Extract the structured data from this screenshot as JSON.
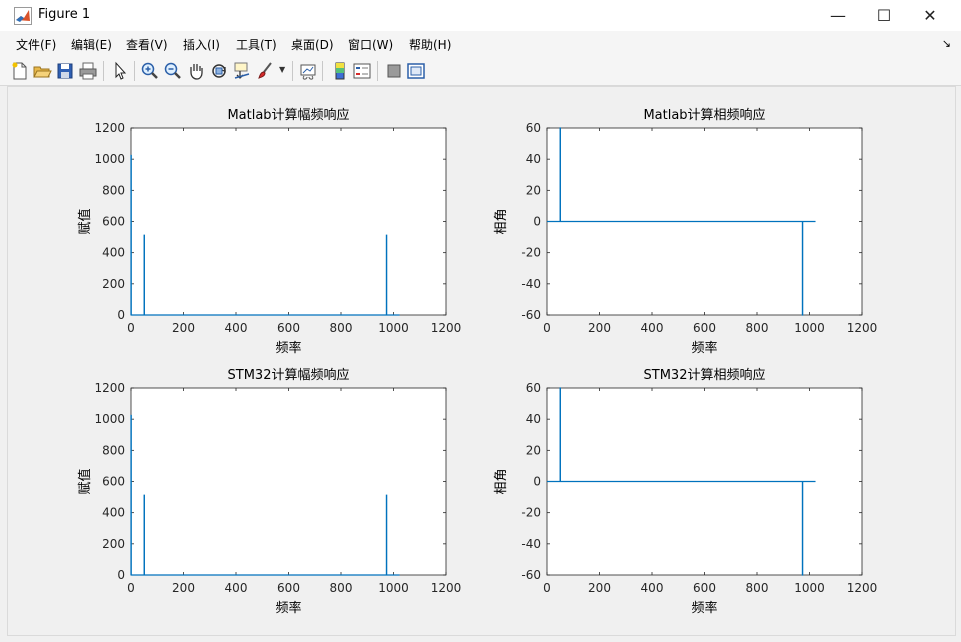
{
  "window": {
    "title": "Figure 1",
    "controls": {
      "minimize": "—",
      "maximize": "☐",
      "close": "✕"
    }
  },
  "menu": [
    {
      "label": "文件(F)"
    },
    {
      "label": "编辑(E)"
    },
    {
      "label": "查看(V)"
    },
    {
      "label": "插入(I)"
    },
    {
      "label": "工具(T)"
    },
    {
      "label": "桌面(D)"
    },
    {
      "label": "窗口(W)"
    },
    {
      "label": "帮助(H)"
    }
  ],
  "toolbar": [
    {
      "icon": "new-figure-icon"
    },
    {
      "icon": "open-file-icon"
    },
    {
      "icon": "save-icon"
    },
    {
      "icon": "print-icon"
    },
    {
      "icon": "pointer-icon"
    },
    {
      "icon": "zoom-in-icon"
    },
    {
      "icon": "zoom-out-icon"
    },
    {
      "icon": "pan-hand-icon"
    },
    {
      "icon": "rotate-3d-icon"
    },
    {
      "icon": "data-cursor-icon"
    },
    {
      "icon": "brush-icon"
    },
    {
      "icon": "link-plot-icon"
    },
    {
      "icon": "colorbar-icon"
    },
    {
      "icon": "legend-icon"
    },
    {
      "icon": "hide-plot-tools-icon"
    },
    {
      "icon": "show-plot-tools-icon"
    }
  ],
  "colors": {
    "line": "#0072bd",
    "axes_bg": "#ffffff",
    "figure_bg": "#f0f0f0"
  },
  "chart_data": [
    {
      "type": "line",
      "title": "Matlab计算幅频响应",
      "xlabel": "频率",
      "ylabel": "赋值",
      "xlim": [
        0,
        1200
      ],
      "ylim": [
        0,
        1200
      ],
      "xticks": [
        0,
        200,
        400,
        600,
        800,
        1000,
        1200
      ],
      "yticks": [
        0,
        200,
        400,
        600,
        800,
        1000,
        1200
      ],
      "grid": false,
      "series": [
        {
          "x": [
            0,
            0,
            1,
            1,
            50,
            50,
            51,
            51,
            973,
            973,
            974,
            974,
            1023
          ],
          "y": [
            0,
            1024,
            1024,
            0,
            0,
            512,
            512,
            0,
            0,
            512,
            512,
            0,
            0
          ]
        }
      ]
    },
    {
      "type": "line",
      "title": "Matlab计算相频响应",
      "xlabel": "频率",
      "ylabel": "相角",
      "xlim": [
        0,
        1200
      ],
      "ylim": [
        -60,
        60
      ],
      "xticks": [
        0,
        200,
        400,
        600,
        800,
        1000,
        1200
      ],
      "yticks": [
        -60,
        -40,
        -20,
        0,
        20,
        40,
        60
      ],
      "grid": false,
      "series": [
        {
          "x": [
            0,
            50,
            50,
            51,
            51,
            973,
            973,
            974,
            974,
            1023
          ],
          "y": [
            0,
            0,
            60,
            60,
            0,
            0,
            -60,
            -60,
            0,
            0
          ]
        }
      ]
    },
    {
      "type": "line",
      "title": "STM32计算幅频响应",
      "xlabel": "频率",
      "ylabel": "赋值",
      "xlim": [
        0,
        1200
      ],
      "ylim": [
        0,
        1200
      ],
      "xticks": [
        0,
        200,
        400,
        600,
        800,
        1000,
        1200
      ],
      "yticks": [
        0,
        200,
        400,
        600,
        800,
        1000,
        1200
      ],
      "grid": false,
      "series": [
        {
          "x": [
            0,
            0,
            1,
            1,
            50,
            50,
            51,
            51,
            973,
            973,
            974,
            974,
            1023
          ],
          "y": [
            0,
            1024,
            1024,
            0,
            0,
            512,
            512,
            0,
            0,
            512,
            512,
            0,
            0
          ]
        }
      ]
    },
    {
      "type": "line",
      "title": "STM32计算相频响应",
      "xlabel": "频率",
      "ylabel": "相角",
      "xlim": [
        0,
        1200
      ],
      "ylim": [
        -60,
        60
      ],
      "xticks": [
        0,
        200,
        400,
        600,
        800,
        1000,
        1200
      ],
      "yticks": [
        -60,
        -40,
        -20,
        0,
        20,
        40,
        60
      ],
      "grid": false,
      "series": [
        {
          "x": [
            0,
            50,
            50,
            51,
            51,
            973,
            973,
            974,
            974,
            1023
          ],
          "y": [
            0,
            0,
            60,
            60,
            0,
            0,
            -60,
            -60,
            0,
            0
          ]
        }
      ]
    }
  ]
}
